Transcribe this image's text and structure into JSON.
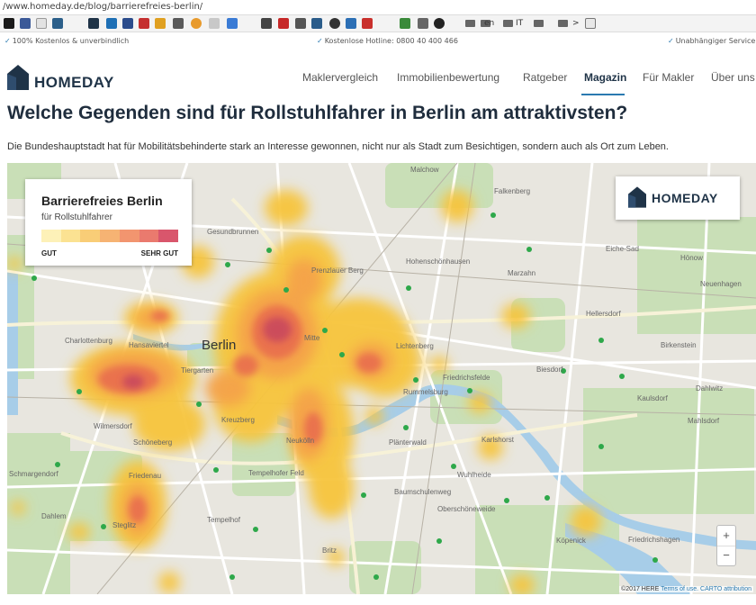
{
  "browser": {
    "url": "/www.homeday.de/blog/barrierefreies-berlin/",
    "bookmark_texts": [
      "en",
      "IT",
      ">"
    ]
  },
  "topstrip": {
    "left": "100% Kostenlos & unverbindlich",
    "center": "Kostenlose Hotline: 0800 40 400 466",
    "right": "Unabhängiger Service"
  },
  "header": {
    "logo_text": "HOMEDAY",
    "nav": [
      "Maklervergleich",
      "Immobilienbewertung",
      "Ratgeber",
      "Magazin",
      "Für Makler",
      "Über uns"
    ],
    "active_nav": "Magazin"
  },
  "article": {
    "title": "Welche Gegenden sind für Rollstuhlfahrer in Berlin am attraktivsten?",
    "intro": "Die Bundeshauptstadt hat für Mobilitätsbehinderte stark an Interesse gewonnen, nicht nur als Stadt zum Besichtigen, sondern auch als Ort zum Leben."
  },
  "map": {
    "legend": {
      "title": "Barrierefreies Berlin",
      "subtitle": "für Rollstuhlfahrer",
      "low_label": "GUT",
      "high_label": "SEHR GUT",
      "colors": [
        "#fdf1b8",
        "#fbe292",
        "#f9cd77",
        "#f6b373",
        "#f2956f",
        "#ea7a6e",
        "#d9566c"
      ]
    },
    "brand_text": "HOMEDAY",
    "city_label": "Berlin",
    "place_labels": [
      "Malchow",
      "Falkenberg",
      "Gesundbrunnen",
      "Hohenschönhausen",
      "Marzahn",
      "Eiche-Sad",
      "Hönow",
      "Charlottenburg",
      "Hansaviertel",
      "Tiergarten",
      "Mitte",
      "Prenzlauer Berg",
      "Lichtenberg",
      "Friedrichsfelde",
      "Biesdorf",
      "Kaulsdorf",
      "Rummelsburg",
      "Kreuzberg",
      "Schöneberg",
      "Wilmersdorf",
      "Schmargendorf",
      "Friedenau",
      "Steglitz",
      "Tempelhof",
      "Neukölln",
      "Plänterwald",
      "Baumschulenweg",
      "Oberschöneweide",
      "Wuhlheide",
      "Karlshorst",
      "Köpenick",
      "Friedrichshagen",
      "Dahlem",
      "Britz",
      "Mahlsdorf",
      "Hellersdorf",
      "Birkenstein",
      "Dahlwitz",
      "Neuenhagen",
      "Tempelhofer Feld"
    ],
    "zoom_in": "+",
    "zoom_out": "−",
    "attribution": "©2017 HERE",
    "attribution_links": [
      "Terms of use.",
      "CARTO",
      "attribution"
    ]
  }
}
